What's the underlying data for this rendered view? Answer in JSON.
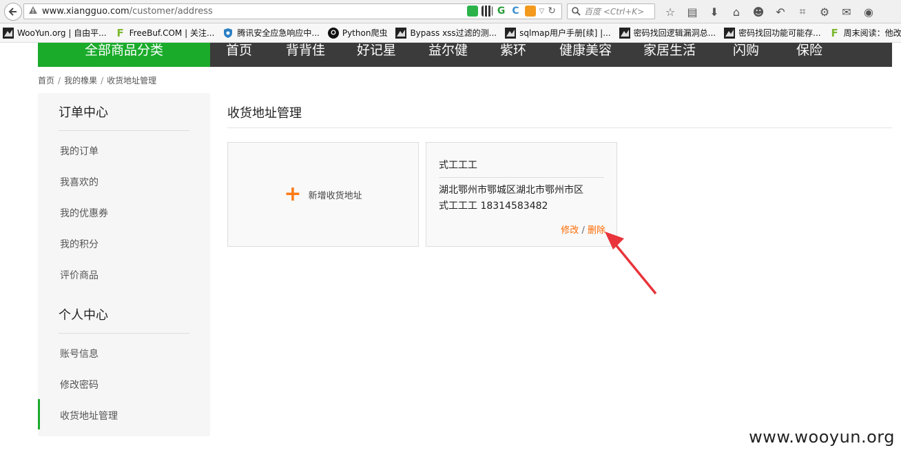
{
  "browser": {
    "url_domain": "www.xiangguo.com",
    "url_path": "/customer/address",
    "search_placeholder": "百度 <Ctrl+K>"
  },
  "bookmarks": [
    {
      "label": "WooYun.org | 自由平...",
      "icon": "wooyun-icon"
    },
    {
      "label": "FreeBuf.COM | 关注...",
      "icon": "freebuf-icon"
    },
    {
      "label": "腾讯安全应急响应中...",
      "icon": "tencent-shield-icon"
    },
    {
      "label": "Python爬虫",
      "icon": "github-icon"
    },
    {
      "label": "Bypass xss过滤的测...",
      "icon": "wooyun-icon"
    },
    {
      "label": "sqlmap用户手册[续] |...",
      "icon": "wooyun-icon"
    },
    {
      "label": "密码找回逻辑漏洞总...",
      "icon": "wooyun-icon"
    },
    {
      "label": "密码找回功能可能存...",
      "icon": "wooyun-icon"
    },
    {
      "label": "周末阅读：他改了",
      "icon": "freebuf-icon"
    }
  ],
  "nav": {
    "category": "全部商品分类",
    "items": [
      "首页",
      "背背佳",
      "好记星",
      "益尔健",
      "紫环",
      "健康美容",
      "家居生活",
      "闪购",
      "保险"
    ]
  },
  "breadcrumb": [
    "首页",
    "我的橡果",
    "收货地址管理"
  ],
  "sidebar": {
    "order_center": "订单中心",
    "order_items": [
      "我的订单",
      "我喜欢的",
      "我的优惠券",
      "我的积分",
      "评价商品"
    ],
    "personal_center": "个人中心",
    "personal_items": [
      "账号信息",
      "修改密码",
      "收货地址管理"
    ]
  },
  "main": {
    "title": "收货地址管理",
    "add_label": "新增收货地址",
    "address": {
      "name": "式工工工",
      "line1": "湖北鄂州市鄂城区湖北市鄂州市区",
      "line2": "式工工工 18314583482",
      "edit": "修改",
      "separator": "/",
      "delete": "删除"
    }
  },
  "watermark": "www.wooyun.org",
  "colors": {
    "brand_green": "#1aab2b",
    "nav_dark": "#3b3b3b",
    "accent_orange": "#ff7a15",
    "arrow_red": "#e8343a"
  }
}
